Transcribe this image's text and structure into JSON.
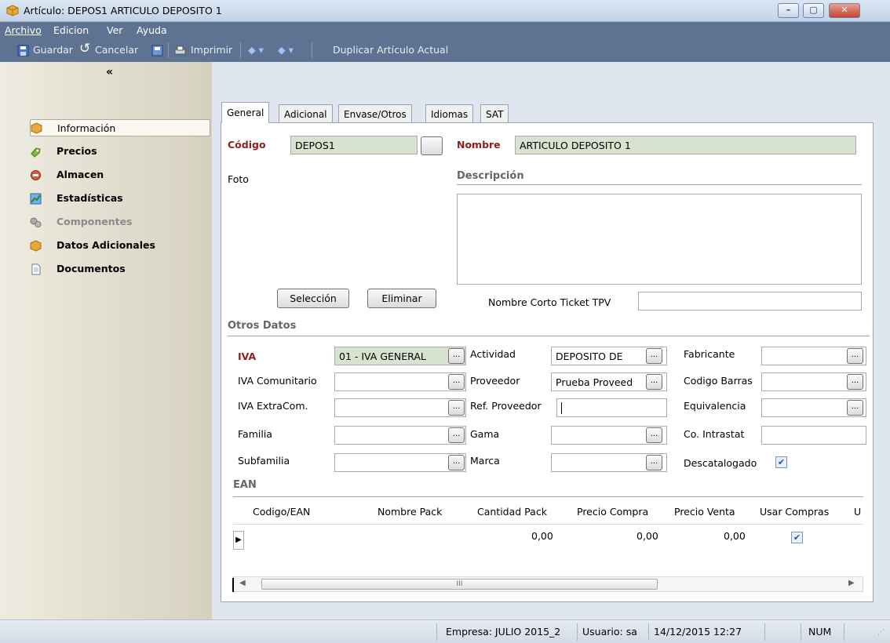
{
  "window": {
    "title": "Artículo: DEPOS1 ARTICULO DEPOSITO 1"
  },
  "menu": [
    "Archivo",
    "Edicion",
    "Ver",
    "Ayuda"
  ],
  "toolbar": {
    "save": "Guardar",
    "cancel": "Cancelar",
    "print": "Imprimir",
    "duplicate": "Duplicar Artículo Actual"
  },
  "sidebar": {
    "collapse": "«",
    "items": [
      {
        "label": "Información",
        "icon": "box-icon"
      },
      {
        "label": "Precios",
        "icon": "prices-icon"
      },
      {
        "label": "Almacen",
        "icon": "warehouse-icon"
      },
      {
        "label": "Estadísticas",
        "icon": "stats-icon"
      },
      {
        "label": "Componentes",
        "icon": "components-icon"
      },
      {
        "label": "Datos Adicionales",
        "icon": "box-icon"
      },
      {
        "label": "Documentos",
        "icon": "document-icon"
      }
    ]
  },
  "tabs": [
    "General",
    "Adicional",
    "Envase/Otros",
    "Idiomas",
    "SAT"
  ],
  "general": {
    "codigo_label": "Código",
    "codigo_value": "DEPOS1",
    "nombre_label": "Nombre",
    "nombre_value": "ARTICULO DEPOSITO 1",
    "foto_label": "Foto",
    "descripcion_label": "Descripción",
    "seleccion_button": "Selección",
    "eliminar_button": "Eliminar",
    "nombre_corto_label": "Nombre Corto Ticket TPV",
    "nombre_corto_value": ""
  },
  "otros": {
    "title": "Otros Datos",
    "iva_label": "IVA",
    "iva_value": "01 - IVA GENERAL",
    "iva_comunitario_label": "IVA Comunitario",
    "iva_extracom_label": "IVA ExtraCom.",
    "familia_label": "Familia",
    "subfamilia_label": "Subfamilia",
    "actividad_label": "Actividad",
    "actividad_value": "DEPOSITO DE",
    "proveedor_label": "Proveedor",
    "proveedor_value": "Prueba Proveed",
    "ref_proveedor_label": "Ref. Proveedor",
    "gama_label": "Gama",
    "marca_label": "Marca",
    "fabricante_label": "Fabricante",
    "codigo_barras_label": "Codigo Barras",
    "equivalencia_label": "Equivalencia",
    "intrastat_label": "Co. Intrastat",
    "descatalogado_label": "Descatalogado",
    "descatalogado_checked": true,
    "dots": "..."
  },
  "ean": {
    "title": "EAN",
    "columns": [
      "Codigo/EAN",
      "Nombre Pack",
      "Cantidad Pack",
      "Precio Compra",
      "Precio Venta",
      "Usar Compras",
      "U"
    ],
    "row": {
      "cantidad_pack": "0,00",
      "precio_compra": "0,00",
      "precio_venta": "0,00",
      "usar_compras": true
    },
    "scroll_grip": "III"
  },
  "status": {
    "empresa": "Empresa: JULIO 2015_2",
    "usuario": "Usuario: sa",
    "fecha": "14/12/2015 12:27",
    "num": "NUM"
  }
}
